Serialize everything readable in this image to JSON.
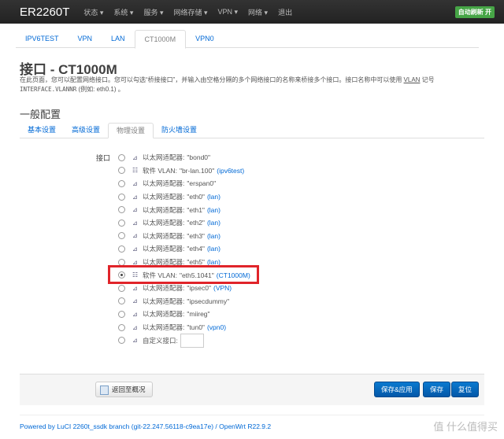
{
  "nav": {
    "brand": "ER2260T",
    "menus": [
      "状态 ▾",
      "系统 ▾",
      "服务 ▾",
      "网络存储 ▾",
      "VPN ▾",
      "网络 ▾",
      "退出"
    ],
    "auto_refresh": "自动刷新 开"
  },
  "tabs": [
    "IPV6TEST",
    "VPN",
    "LAN",
    "CT1000M",
    "VPN0"
  ],
  "title": "接口 - CT1000M",
  "description": {
    "line1_pre": "在此页面，您可以配置网络接口。您可以勾选“桥接接口”，并输入由空格分隔的多个网络接口的名称来桥接多个接口。接口名称中可以使用 ",
    "vlan": "VLAN",
    "line1_post": " 记号",
    "line2_code": "INTERFACE.VLANNR",
    "line2_rest": " (例如: eth0.1) 。"
  },
  "section_title": "一般配置",
  "subtabs": [
    "基本设置",
    "高级设置",
    "物理设置",
    "防火墙设置"
  ],
  "interface_label": "接口",
  "interfaces": [
    {
      "type": "以太网适配器:",
      "name": "\"bond0\"",
      "net": "",
      "icon": "ethernet-icon"
    },
    {
      "type": "软件 VLAN:",
      "name": "\"br-lan.100\"",
      "net": "(ipv6test)",
      "icon": "vlan-icon"
    },
    {
      "type": "以太网适配器:",
      "name": "\"erspan0\"",
      "net": "",
      "icon": "ethernet-icon"
    },
    {
      "type": "以太网适配器:",
      "name": "\"eth0\"",
      "net": "(lan)",
      "icon": "ethernet-icon"
    },
    {
      "type": "以太网适配器:",
      "name": "\"eth1\"",
      "net": "(lan)",
      "icon": "ethernet-icon"
    },
    {
      "type": "以太网适配器:",
      "name": "\"eth2\"",
      "net": "(lan)",
      "icon": "ethernet-icon"
    },
    {
      "type": "以太网适配器:",
      "name": "\"eth3\"",
      "net": "(lan)",
      "icon": "ethernet-icon"
    },
    {
      "type": "以太网适配器:",
      "name": "\"eth4\"",
      "net": "(lan)",
      "icon": "ethernet-icon"
    },
    {
      "type": "以太网适配器:",
      "name": "\"eth5\"",
      "net": "(lan)",
      "icon": "ethernet-icon"
    },
    {
      "type": "软件 VLAN:",
      "name": "\"eth5.1041\"",
      "net": "(CT1000M)",
      "icon": "vlan-icon",
      "selected": true
    },
    {
      "type": "以太网适配器:",
      "name": "\"ipsec0\"",
      "net": "(VPN)",
      "icon": "ethernet-icon"
    },
    {
      "type": "以太网适配器:",
      "name": "\"ipsecdummy\"",
      "net": "",
      "icon": "ethernet-icon"
    },
    {
      "type": "以太网适配器:",
      "name": "\"miireg\"",
      "net": "",
      "icon": "ethernet-icon"
    },
    {
      "type": "以太网适配器:",
      "name": "\"tun0\"",
      "net": "(vpn0)",
      "icon": "ethernet-icon"
    }
  ],
  "custom_label": "自定义接口:",
  "custom_value": "",
  "actions": {
    "back": "返回至概况",
    "save_apply": "保存&应用",
    "save": "保存",
    "reset": "复位"
  },
  "footer": "Powered by LuCI 2260t_ssdk branch (git-22.247.56118-c9ea17e) / OpenWrt R22.9.2",
  "watermark": "值 什么值得买"
}
